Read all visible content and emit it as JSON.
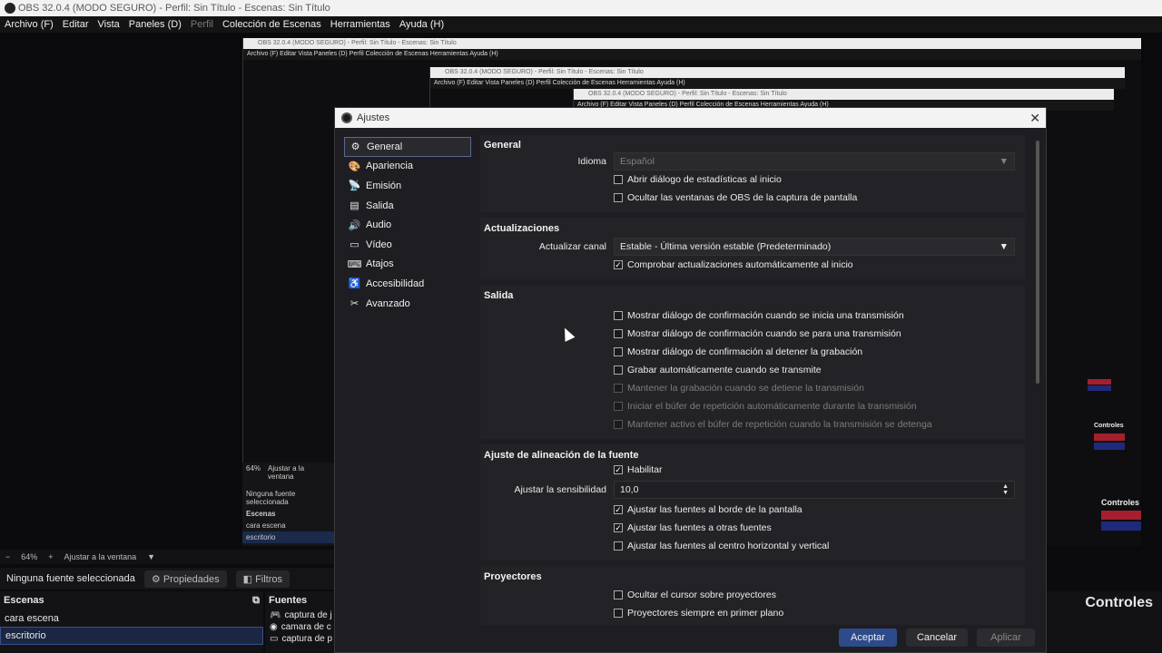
{
  "window": {
    "title": "OBS 32.0.4 (MODO SEGURO) - Perfil: Sin Título - Escenas: Sin Título",
    "menu": [
      "Archivo (F)",
      "Editar",
      "Vista",
      "Paneles (D)",
      "Perfil",
      "Colección de Escenas",
      "Herramientas",
      "Ayuda (H)"
    ]
  },
  "nested": {
    "title": "OBS 32.0.4 (MODO SEGURO) - Perfil: Sin Título - Escenas: Sin Título",
    "menu": "Archivo (F)   Editar   Vista   Paneles (D)   Perfil   Colección de Escenas   Herramientas   Ayuda (H)",
    "zoom": "64%",
    "fit": "Ajustar a la ventana",
    "no_source": "Ninguna fuente seleccionada",
    "scenes_title": "Escenas",
    "scene1": "cara escena",
    "scene2": "escritorio",
    "controls": "Controles"
  },
  "bottom": {
    "zoom": "64%",
    "fit": "Ajustar a la ventana",
    "no_source": "Ninguna fuente seleccionada",
    "properties": "Propiedades",
    "filters": "Filtros",
    "scenes_title": "Escenas",
    "scenes": [
      "cara escena",
      "escritorio"
    ],
    "sources_title": "Fuentes",
    "sources": [
      "captura de j",
      "camara de c",
      "captura de p"
    ],
    "controls_title": "Controles"
  },
  "dialog": {
    "title": "Ajustes",
    "nav": [
      "General",
      "Apariencia",
      "Emisión",
      "Salida",
      "Audio",
      "Vídeo",
      "Atajos",
      "Accesibilidad",
      "Avanzado"
    ],
    "general": {
      "title": "General",
      "language_label": "Idioma",
      "language_value": "Español",
      "stats_dialog": "Abrir diálogo de estadísticas al inicio",
      "hide_windows": "Ocultar las ventanas de OBS de la captura de pantalla"
    },
    "updates": {
      "title": "Actualizaciones",
      "channel_label": "Actualizar canal",
      "channel_value": "Estable - Última versión estable (Predeterminado)",
      "auto_check": "Comprobar actualizaciones automáticamente al inicio"
    },
    "output": {
      "title": "Salida",
      "opt1": "Mostrar diálogo de confirmación cuando se inicia una transmisión",
      "opt2": "Mostrar diálogo de confirmación cuando se para una transmisión",
      "opt3": "Mostrar diálogo de confirmación al detener la grabación",
      "opt4": "Grabar automáticamente cuando se transmite",
      "opt5": "Mantener la grabación cuando se detiene la transmisión",
      "opt6": "Iniciar el búfer de repetición automáticamente durante la transmisión",
      "opt7": "Mantener activo el búfer de repetición cuando la transmisión se detenga"
    },
    "snapping": {
      "title": "Ajuste de alineación de la fuente",
      "enable": "Habilitar",
      "sensitivity_label": "Ajustar la sensibilidad",
      "sensitivity_value": "10,0",
      "edges": "Ajustar las fuentes al borde de la pantalla",
      "other": "Ajustar las fuentes a otras fuentes",
      "center": "Ajustar las fuentes al centro horizontal y vertical"
    },
    "projectors": {
      "title": "Proyectores",
      "hide_cursor": "Ocultar el cursor sobre proyectores",
      "on_top": "Proyectores siempre en primer plano"
    },
    "buttons": {
      "ok": "Aceptar",
      "cancel": "Cancelar",
      "apply": "Aplicar"
    }
  },
  "colors": {
    "accent": "#2d4a8a",
    "red": "#a51f2f",
    "blue": "#1f2a7a"
  }
}
